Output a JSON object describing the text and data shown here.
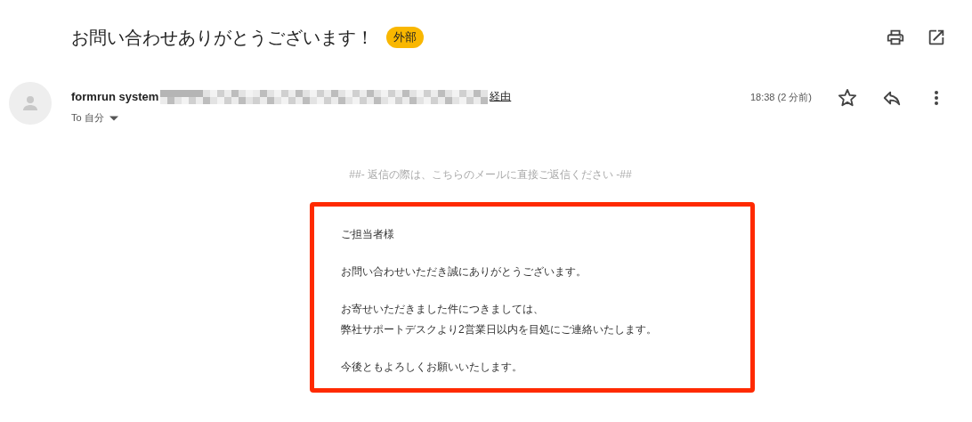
{
  "subject": "お問い合わせありがとうございます！",
  "label": {
    "text": "外部",
    "color": "#f9b700"
  },
  "sender": {
    "name": "formrun system",
    "via": "経由",
    "recipient": "To 自分"
  },
  "time": "18:38 (2 分前)",
  "starred": false,
  "notice": "##- 返信の際は、こちらのメールに直接ご返信ください -##",
  "paragraphs": [
    [
      "ご担当者様"
    ],
    [
      "お問い合わせいただき誠にありがとうございます。"
    ],
    [
      "お寄せいただきました件につきましては、",
      "弊社サポートデスクより2営業日以内を目処にご連絡いたします。"
    ],
    [
      "今後ともよろしくお願いいたします。"
    ]
  ]
}
